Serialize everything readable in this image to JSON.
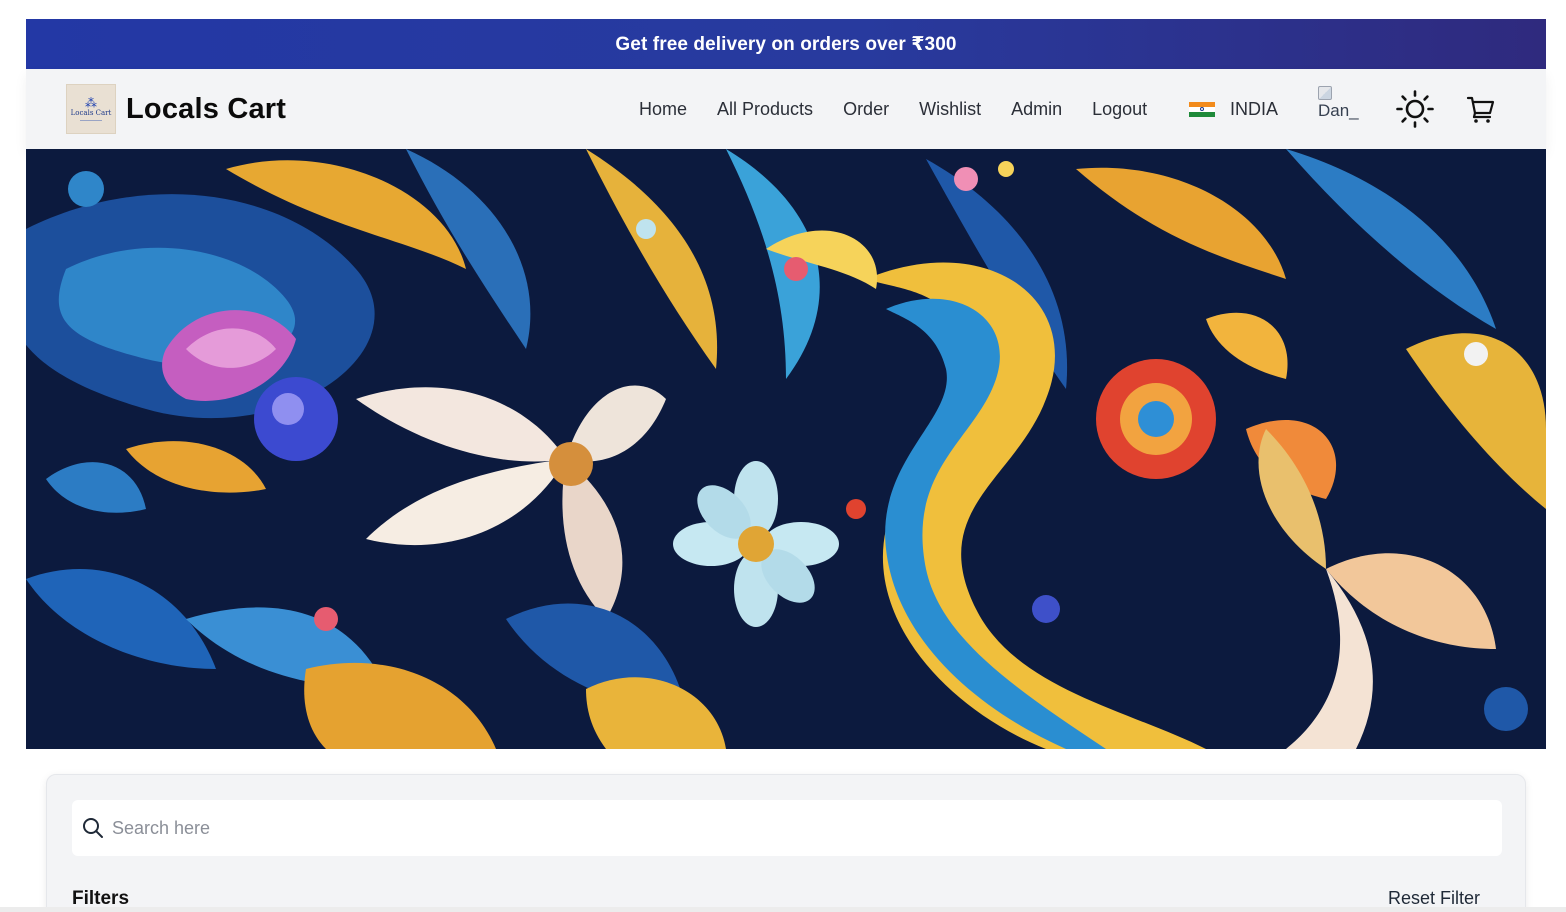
{
  "promo": {
    "text": "Get free delivery on orders over ₹300"
  },
  "brand": {
    "name": "Locals Cart",
    "logo_text": "Locals Cart"
  },
  "nav": {
    "links": [
      {
        "label": "Home"
      },
      {
        "label": "All Products"
      },
      {
        "label": "Order"
      },
      {
        "label": "Wishlist"
      },
      {
        "label": "Admin"
      },
      {
        "label": "Logout"
      }
    ]
  },
  "country": {
    "name": "INDIA",
    "flag_icon": "india-flag-icon"
  },
  "avatar": {
    "alt": "Dan_"
  },
  "icons": {
    "theme": "sun-icon",
    "cart": "cart-icon",
    "search": "search-icon"
  },
  "search": {
    "placeholder": "Search here",
    "value": ""
  },
  "filters": {
    "title": "Filters",
    "reset_label": "Reset Filter"
  },
  "colors": {
    "promo_start": "#2338a5",
    "promo_end": "#2f2a7e",
    "navbar_bg": "#f3f4f6"
  }
}
